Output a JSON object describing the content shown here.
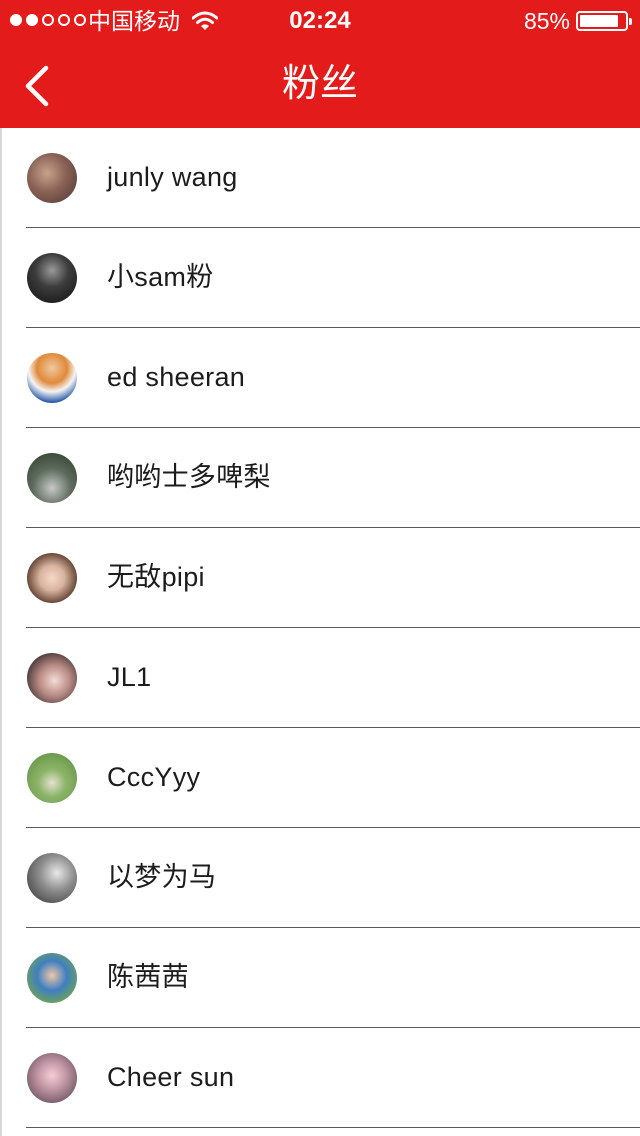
{
  "status_bar": {
    "carrier": "中国移动",
    "time": "02:24",
    "battery_percent": "85%",
    "battery_level": 0.85,
    "signal_strength": 2
  },
  "nav": {
    "title": "粉丝",
    "back_icon": "chevron-left-icon"
  },
  "colors": {
    "header_bg": "#e31b1b",
    "text": "#1c1c1c",
    "divider": "#5a5a5a"
  },
  "followers": [
    {
      "name": "junly wang"
    },
    {
      "name": "小sam粉"
    },
    {
      "name": "ed sheeran"
    },
    {
      "name": "哟哟士多啤梨"
    },
    {
      "name": "无敌pipi"
    },
    {
      "name": "JL1"
    },
    {
      "name": "CccYyy"
    },
    {
      "name": "以梦为马"
    },
    {
      "name": "陈茜茜"
    },
    {
      "name": "Cheer sun"
    }
  ]
}
